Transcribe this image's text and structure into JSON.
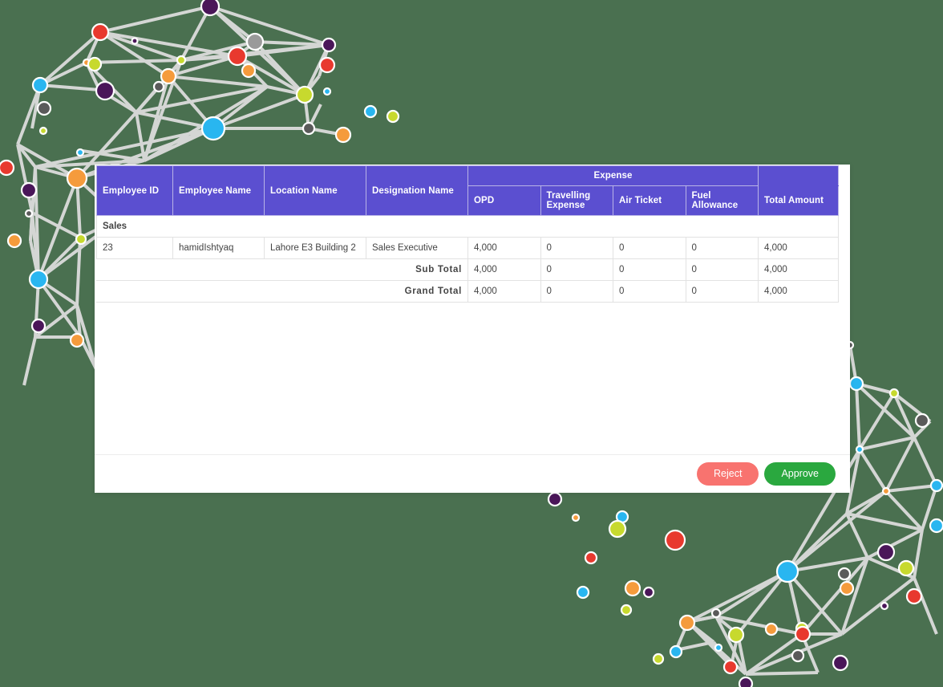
{
  "theme": {
    "page_background": "#4a7050",
    "header_purple": "#5b4fd0",
    "reject_color": "#f8736f",
    "approve_color": "#2aa83f"
  },
  "table": {
    "primary_headers": [
      "Employee ID",
      "Employee Name",
      "Location Name",
      "Designation Name"
    ],
    "group_header": "Expense",
    "expense_headers": [
      "OPD",
      "Travelling Expense",
      "Air Ticket",
      "Fuel Allowance"
    ],
    "total_header": "Total Amount",
    "group_row_label": "Sales",
    "rows": [
      {
        "employee_id": "23",
        "employee_name": "hamidIshtyaq",
        "location_name": "Lahore E3 Building 2",
        "designation_name": "Sales Executive",
        "opd": "4,000",
        "travelling_expense": "0",
        "air_ticket": "0",
        "fuel_allowance": "0",
        "total_amount": "4,000"
      }
    ],
    "sub_total": {
      "label": "Sub Total",
      "opd": "4,000",
      "travelling_expense": "0",
      "air_ticket": "0",
      "fuel_allowance": "0",
      "total_amount": "4,000"
    },
    "grand_total": {
      "label": "Grand Total",
      "opd": "4,000",
      "travelling_expense": "0",
      "air_ticket": "0",
      "fuel_allowance": "0",
      "total_amount": "4,000"
    }
  },
  "footer": {
    "reject_label": "Reject",
    "approve_label": "Approve"
  },
  "decoration": {
    "name": "network-graph-illustration",
    "node_colors": [
      "#e8392e",
      "#c7d92e",
      "#f59b3c",
      "#29b6f0",
      "#4a1659",
      "#5a5a5a"
    ]
  }
}
